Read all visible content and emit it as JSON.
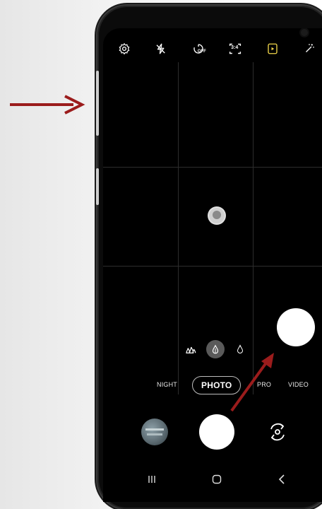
{
  "top_bar": {
    "icons": [
      "settings-icon",
      "flash-off-icon",
      "timer-off-icon",
      "ratio-3-4-icon",
      "motion-photo-icon",
      "filter-icon"
    ],
    "timer_label": "OFF",
    "ratio_label": "3:4"
  },
  "modes": {
    "night": "NIGHT",
    "photo": "PHOTO",
    "pro": "PRO",
    "video": "VIDEO",
    "selected": "PHOTO"
  },
  "zoom": {
    "icons": [
      "ultra-wide-icon",
      "wide-icon",
      "tele-icon"
    ],
    "selected": "wide"
  },
  "nav": {
    "icons": [
      "recent-apps-icon",
      "home-icon",
      "back-icon"
    ]
  },
  "colors": {
    "annotation_arrow": "#9b1c1c",
    "accent_motion_icon": "#f1d64a",
    "screen_bg": "#000000"
  }
}
